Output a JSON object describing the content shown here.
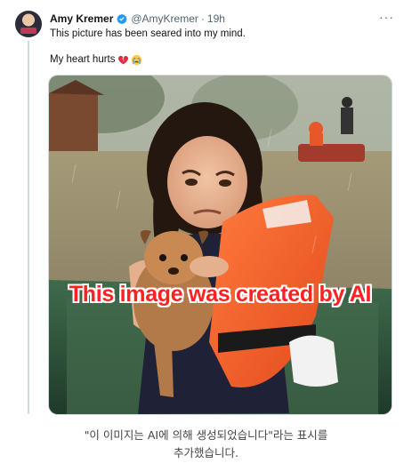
{
  "tweet": {
    "author_name": "Amy Kremer",
    "handle": "@AmyKremer",
    "separator": "·",
    "time": "19h",
    "more_label": "···",
    "line1": "This picture has been seared into my mind.",
    "line2": "My heart hurts",
    "line2_emojis": [
      "broken-heart-icon",
      "crying-face-icon"
    ],
    "verified": true,
    "accent_color": "#1d9bf0"
  },
  "media": {
    "overlay_text": "This image was created by AI",
    "overlay_color": "#ff2020"
  },
  "caption": {
    "line1": "\"이 이미지는 AI에 의해 생성되었습니다\"라는 표시를",
    "line2": "추가했습니다."
  }
}
